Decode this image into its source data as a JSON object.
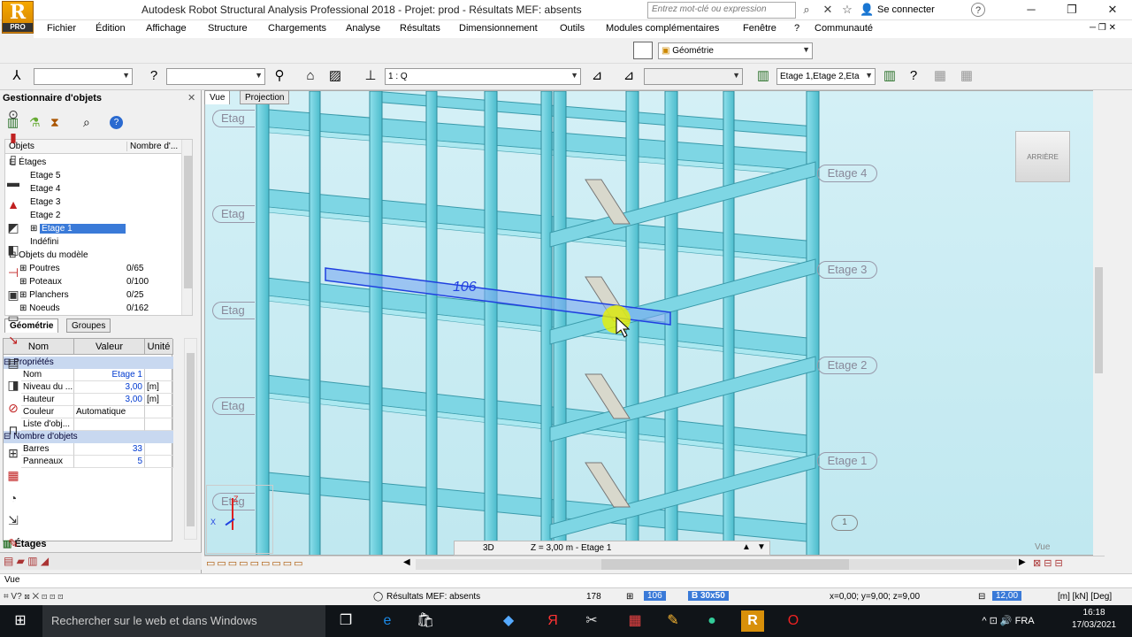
{
  "app": {
    "title": "Autodesk Robot Structural Analysis Professional 2018 - Projet: prod - Résultats MEF: absents",
    "logo_letter": "R",
    "logo_sub": "PRO",
    "search_placeholder": "Entrez mot-clé ou expression",
    "signin": "Se connecter",
    "help": "?"
  },
  "menu": [
    "Fichier",
    "Édition",
    "Affichage",
    "Structure",
    "Chargements",
    "Analyse",
    "Résultats",
    "Dimensionnement",
    "Outils",
    "Modules complémentaires",
    "Fenêtre",
    "?",
    "Communauté"
  ],
  "toolbar": {
    "view_combo": "Géométrie",
    "case_combo": "1 : Q",
    "stories_combo": "Etage 1,Etage 2,Eta"
  },
  "object_manager": {
    "title": "Gestionnaire d'objets",
    "col_objects": "Objets",
    "col_count": "Nombre d'...",
    "tree": [
      {
        "label": "Étages",
        "indent": 0,
        "exp": "⊟"
      },
      {
        "label": "Etage 5",
        "indent": 2,
        "exp": ""
      },
      {
        "label": "Etage 4",
        "indent": 2,
        "exp": ""
      },
      {
        "label": "Etage 3",
        "indent": 2,
        "exp": ""
      },
      {
        "label": "Etage 2",
        "indent": 2,
        "exp": ""
      },
      {
        "label": "Etage 1",
        "indent": 2,
        "exp": "⊞",
        "selected": true
      },
      {
        "label": "Indéfini",
        "indent": 2,
        "exp": ""
      },
      {
        "label": "Objets du modèle",
        "indent": 0,
        "exp": "⊟"
      },
      {
        "label": "Poutres",
        "indent": 1,
        "exp": "⊞",
        "count": "0/65"
      },
      {
        "label": "Poteaux",
        "indent": 1,
        "exp": "⊞",
        "count": "0/100"
      },
      {
        "label": "Planchers",
        "indent": 1,
        "exp": "⊞",
        "count": "0/25"
      },
      {
        "label": "Noeuds",
        "indent": 1,
        "exp": "⊞",
        "count": "0/162"
      }
    ],
    "tabs": [
      "Géométrie",
      "Groupes"
    ]
  },
  "properties": {
    "headers": [
      "Nom",
      "Valeur",
      "Unité"
    ],
    "sections": [
      {
        "title": "Propriétés",
        "rows": [
          {
            "name": "Nom",
            "value": "Etage 1",
            "unit": ""
          },
          {
            "name": "Niveau du ...",
            "value": "3,00",
            "unit": "[m]"
          },
          {
            "name": "Hauteur",
            "value": "3,00",
            "unit": "[m]"
          },
          {
            "name": "Couleur",
            "value": "Automatique",
            "unit": ""
          },
          {
            "name": "Liste d'obj...",
            "value": "",
            "unit": ""
          }
        ]
      },
      {
        "title": "Nombre d'objets",
        "rows": [
          {
            "name": "Barres",
            "value": "33",
            "unit": ""
          },
          {
            "name": "Panneaux",
            "value": "5",
            "unit": ""
          }
        ]
      }
    ],
    "bottom_tab": "Étages"
  },
  "viewport": {
    "tab_vue": "Vue",
    "tab_projection": "Projection",
    "bar_number": "106",
    "story_labels_right": [
      "Etage 4",
      "Etage 3",
      "Etage 2",
      "Etage 1"
    ],
    "story_labels_left": [
      "Etag",
      "Etag",
      "Etag",
      "Etag",
      "Etag"
    ],
    "node_label": "1",
    "cube": "ARRIÈRE",
    "mode": "3D",
    "zinfo": "Z = 3,00 m - Etage 1",
    "vue_label": "Vue",
    "axis_z": "Z",
    "axis_x": "X"
  },
  "statusbar": {
    "vue": "Vue",
    "mef": "Résultats MEF: absents",
    "num": "178",
    "sel": "106",
    "section": "B 30x50",
    "coords": "x=0,00; y=9,00; z=9,00",
    "value": "12,00",
    "units": "[m] [kN] [Deg]"
  },
  "taskbar": {
    "search": "Rechercher sur le web et dans Windows",
    "time": "16:18",
    "date": "17/03/2021"
  }
}
